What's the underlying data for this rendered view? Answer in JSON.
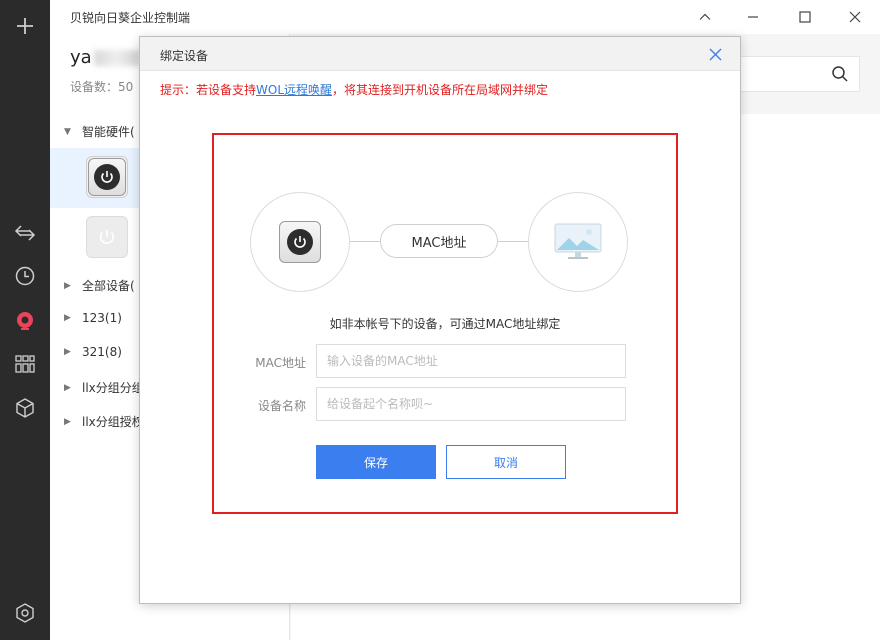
{
  "app": {
    "title": "贝锐向日葵企业控制端"
  },
  "rail": {
    "items": [
      "plus-icon",
      "swap-icon",
      "clock-icon",
      "sunflower-icon",
      "grid-icon",
      "cube-icon",
      "settings-icon"
    ]
  },
  "user": {
    "name_prefix": "ya",
    "device_count": "设备数：50"
  },
  "tree": {
    "group_smart": "智能硬件(",
    "all": "全部设备(",
    "groups": [
      "123(1)",
      "321(8)",
      "llx分组分组",
      "llx分组授权"
    ]
  },
  "dialog": {
    "title": "绑定设备",
    "tip_prefix": "提示：若设备支持",
    "tip_link": "WOL远程唤醒",
    "tip_suffix": "，将其连接到开机设备所在局域网并绑定",
    "mac_pill": "MAC地址",
    "description": "如非本帐号下的设备，可通过MAC地址绑定",
    "mac_label": "MAC地址",
    "mac_placeholder": "输入设备的MAC地址",
    "mac_value": "",
    "name_label": "设备名称",
    "name_placeholder": "给设备起个名称呗~",
    "name_value": "",
    "save": "保存",
    "cancel": "取消"
  },
  "colors": {
    "accent": "#3a7ef0",
    "warning": "#e02020",
    "rail": "#2b2b2b",
    "link": "#2f7ad8"
  }
}
